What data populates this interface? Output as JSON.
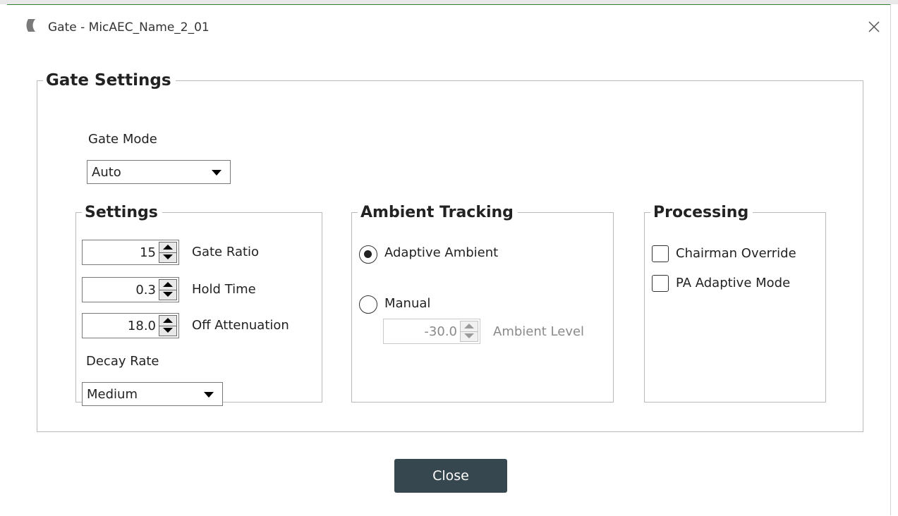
{
  "window": {
    "title": "Gate - MicAEC_Name_2_01",
    "close_icon": "close-x-icon",
    "app_icon": "crescent-logo-icon"
  },
  "gate_settings": {
    "legend": "Gate Settings",
    "gate_mode_label": "Gate Mode",
    "gate_mode_value": "Auto"
  },
  "settings": {
    "legend": "Settings",
    "gate_ratio": {
      "value": "15",
      "label": "Gate Ratio"
    },
    "hold_time": {
      "value": "0.3",
      "label": "Hold Time"
    },
    "off_attenuation": {
      "value": "18.0",
      "label": "Off Attenuation"
    },
    "decay_rate_label": "Decay Rate",
    "decay_rate_value": "Medium"
  },
  "ambient": {
    "legend": "Ambient Tracking",
    "adaptive_label": "Adaptive Ambient",
    "adaptive_selected": true,
    "manual_label": "Manual",
    "manual_selected": false,
    "ambient_level_value": "-30.0",
    "ambient_level_label": "Ambient Level"
  },
  "processing": {
    "legend": "Processing",
    "chairman_override_label": "Chairman Override",
    "chairman_override_checked": false,
    "pa_adaptive_label": "PA Adaptive Mode",
    "pa_adaptive_checked": false
  },
  "footer": {
    "close_label": "Close"
  },
  "colors": {
    "button_bg": "#37474f",
    "border": "#b9b9b9",
    "accent_line": "#2e7d32"
  }
}
